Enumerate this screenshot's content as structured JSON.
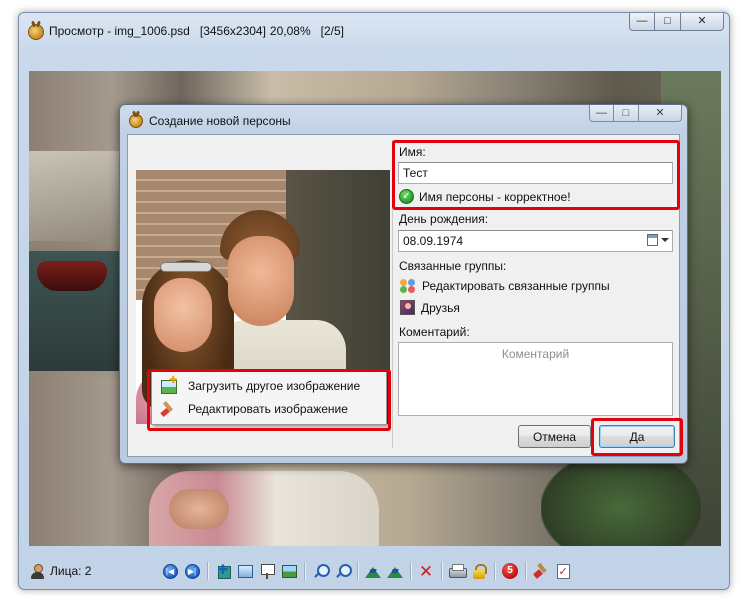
{
  "viewer": {
    "title_app": "Просмотр - img_1006.psd",
    "title_resolution": "[3456x2304]",
    "title_zoom": "20,08%",
    "title_position": "[2/5]",
    "faces_label": "Лица: 2"
  },
  "window_controls": {
    "minimize": "—",
    "maximize": "□",
    "close": "✕"
  },
  "dialog": {
    "title": "Создание новой персоны",
    "name_label": "Имя:",
    "name_value": "Тест",
    "name_status": "Имя персоны - корректное!",
    "birthday_label": "День рождения:",
    "birthday_value": "08.09.1974",
    "groups_label": "Связанные группы:",
    "edit_groups_link": "Редактировать связанные группы",
    "group_friends": "Друзья",
    "comment_label": "Коментарий:",
    "comment_placeholder": "Коментарий",
    "cancel_button": "Отмена",
    "ok_button": "Да"
  },
  "context_menu": {
    "items": [
      {
        "label": "Загрузить другое изображение",
        "icon": "load-image-icon"
      },
      {
        "label": "Редактировать изображение",
        "icon": "edit-image-icon"
      }
    ]
  },
  "toolbar": {
    "icons": [
      "first-image-icon",
      "last-image-icon",
      "fit-to-window-icon",
      "actual-size-icon",
      "slideshow-icon",
      "wallpaper-icon",
      "zoom-out-icon",
      "zoom-in-icon",
      "rotate-left-icon",
      "rotate-right-icon",
      "delete-icon",
      "print-icon",
      "lock-icon",
      "rating-icon",
      "edit-icon",
      "properties-icon"
    ],
    "rating_value": "5"
  },
  "colors": {
    "highlight_red": "#e3000f",
    "titlebar_blue": "#c9d8ea",
    "valid_green": "#1f9b23"
  }
}
